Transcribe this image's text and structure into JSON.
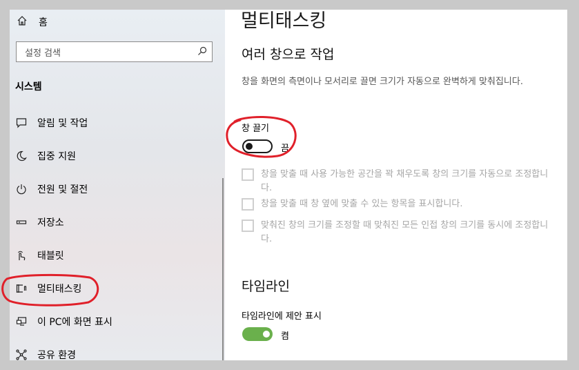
{
  "sidebar": {
    "home_label": "홈",
    "search_placeholder": "설정 검색",
    "section_title": "시스템",
    "items": [
      {
        "label": "알림 및 작업",
        "icon": "notification-icon"
      },
      {
        "label": "집중 지원",
        "icon": "moon-icon"
      },
      {
        "label": "전원 및 절전",
        "icon": "power-icon"
      },
      {
        "label": "저장소",
        "icon": "storage-icon"
      },
      {
        "label": "태블릿",
        "icon": "tablet-icon"
      },
      {
        "label": "멀티태스킹",
        "icon": "multitasking-icon"
      },
      {
        "label": "이 PC에 화면 표시",
        "icon": "project-icon"
      },
      {
        "label": "공유 환경",
        "icon": "share-icon"
      }
    ]
  },
  "main": {
    "title": "멀티태스킹",
    "snap_heading": "여러 창으로 작업",
    "snap_description": "창을 화면의 측면이나 모서리로 끌면 크기가 자동으로 완벽하게 맞춰집니다.",
    "snap_toggle": {
      "label": "창 끌기",
      "state": "끔"
    },
    "options": [
      {
        "text": "창을 맞출 때 사용 가능한 공간을 꽉 채우도록 창의 크기를 자동으로 조정합니다."
      },
      {
        "text": "창을 맞출 때 창 옆에 맞출 수 있는 항목을 표시합니다."
      },
      {
        "text": "맞춰진 창의 크기를 조정할 때 맞춰진 모든 인접 창의 크기를 동시에 조정합니다."
      }
    ],
    "timeline_heading": "타임라인",
    "timeline_toggle": {
      "label": "타임라인에 제안 표시",
      "state": "켬"
    }
  },
  "colors": {
    "toggle_on": "#6ab04c",
    "annotation": "#e0202a"
  }
}
